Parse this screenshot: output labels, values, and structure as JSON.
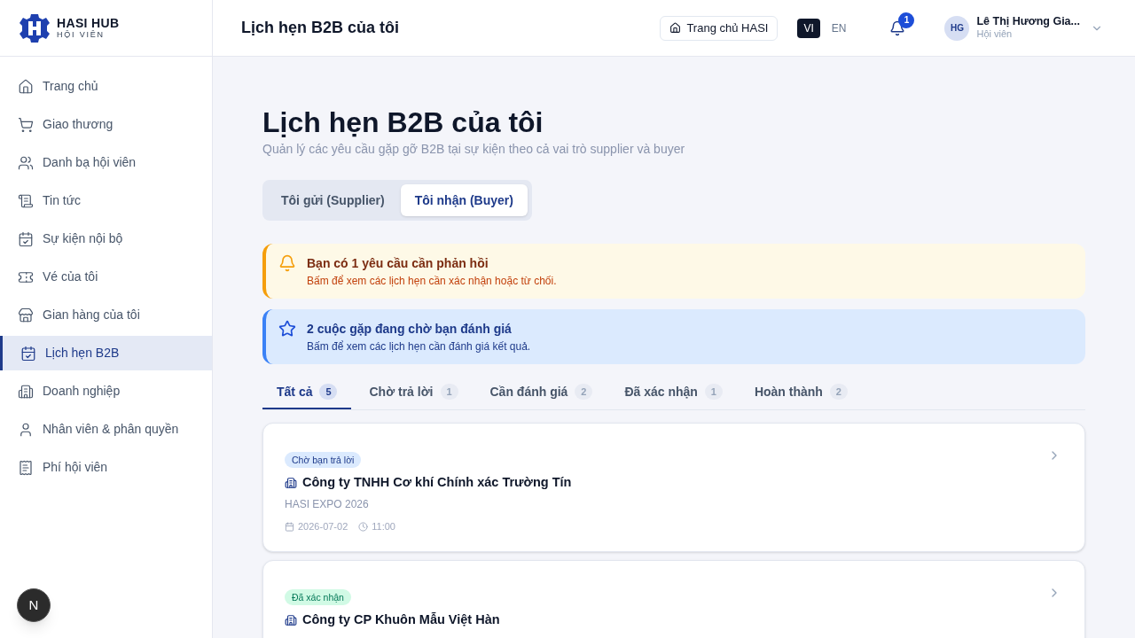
{
  "brand": {
    "name": "HASI HUB",
    "subtitle": "HỘI VIÊN"
  },
  "sidebar": {
    "items": [
      {
        "label": "Trang chủ",
        "selected": false
      },
      {
        "label": "Giao thương",
        "selected": false
      },
      {
        "label": "Danh bạ hội viên",
        "selected": false
      },
      {
        "label": "Tin tức",
        "selected": false
      },
      {
        "label": "Sự kiện nội bộ",
        "selected": false
      },
      {
        "label": "Vé của tôi",
        "selected": false
      },
      {
        "label": "Gian hàng của tôi",
        "selected": false
      },
      {
        "label": "Lịch hẹn B2B",
        "selected": true
      },
      {
        "label": "Doanh nghiệp",
        "selected": false
      },
      {
        "label": "Nhân viên & phân quyền",
        "selected": false
      },
      {
        "label": "Phí hội viên",
        "selected": false
      }
    ]
  },
  "dev_badge": "N",
  "header": {
    "title": "Lịch hẹn B2B của tôi",
    "home_button": "Trang chủ HASI",
    "languages": [
      {
        "label": "VI",
        "selected": true
      },
      {
        "label": "EN",
        "selected": false
      }
    ],
    "notification_count": "1",
    "user": {
      "initials": "HG",
      "name": "Lê Thị Hương Gia...",
      "role": "Hội viên"
    }
  },
  "page": {
    "title": "Lịch hẹn B2B của tôi",
    "subtitle": "Quản lý các yêu cầu gặp gỡ B2B tại sự kiện theo cả vai trò supplier và buyer"
  },
  "role_tabs": [
    {
      "label": "Tôi gửi (Supplier)",
      "selected": false
    },
    {
      "label": "Tôi nhận (Buyer)",
      "selected": true
    }
  ],
  "alerts": [
    {
      "kind": "warning",
      "title": "Bạn có 1 yêu cầu cần phản hồi",
      "text": "Bấm để xem các lịch hẹn cần xác nhận hoặc từ chối."
    },
    {
      "kind": "info",
      "title": "2 cuộc gặp đang chờ bạn đánh giá",
      "text": "Bấm để xem các lịch hẹn cần đánh giá kết quả."
    }
  ],
  "filter_tabs": [
    {
      "label": "Tất cả",
      "count": "5",
      "selected": true
    },
    {
      "label": "Chờ trả lời",
      "count": "1",
      "selected": false
    },
    {
      "label": "Cần đánh giá",
      "count": "2",
      "selected": false
    },
    {
      "label": "Đã xác nhận",
      "count": "1",
      "selected": false
    },
    {
      "label": "Hoàn thành",
      "count": "2",
      "selected": false
    }
  ],
  "appointments": [
    {
      "status": "Chờ bạn trả lời",
      "kind": "pending",
      "company": "Công ty TNHH Cơ khí Chính xác Trường Tín",
      "event": "HASI EXPO 2026",
      "date": "2026-07-02",
      "time": "11:00"
    },
    {
      "status": "Đã xác nhận",
      "kind": "confirmed",
      "company": "Công ty CP Khuôn Mẫu Việt Hàn"
    }
  ]
}
